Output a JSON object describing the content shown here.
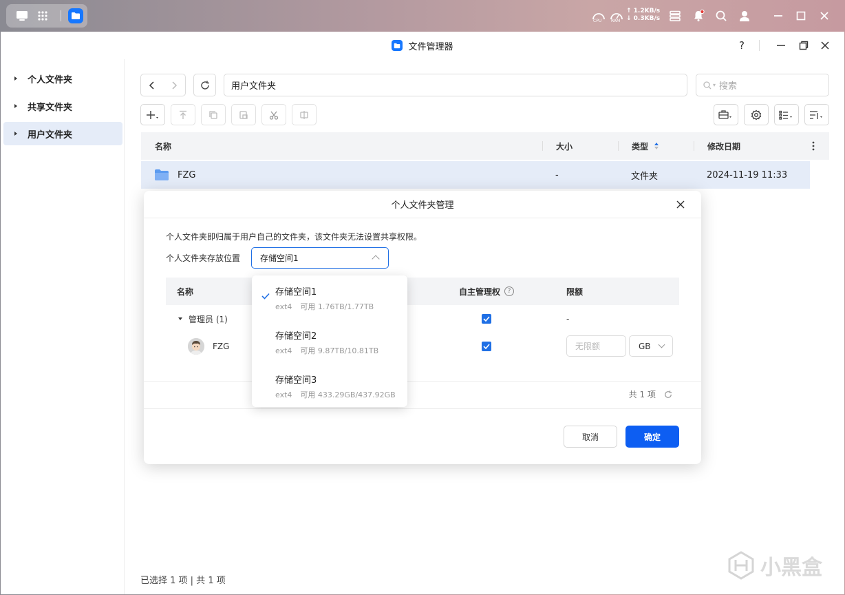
{
  "taskbar": {
    "cpu_label": "CPU",
    "ram_label": "RAM",
    "upload_speed": "↑ 1.2KB/s",
    "download_speed": "↓ 0.3KB/s",
    "notification_dot_color": "#e53935"
  },
  "window": {
    "title": "文件管理器",
    "help_label": "?"
  },
  "sidebar": {
    "items": [
      {
        "label": "个人文件夹",
        "active": false
      },
      {
        "label": "共享文件夹",
        "active": false
      },
      {
        "label": "用户文件夹",
        "active": true
      }
    ]
  },
  "toolbar": {
    "path": "用户文件夹",
    "search_placeholder": "搜索"
  },
  "table": {
    "columns": [
      "名称",
      "大小",
      "类型",
      "修改日期"
    ],
    "sort_column": "类型",
    "rows": [
      {
        "name": "FZG",
        "size": "-",
        "type": "文件夹",
        "modified": "2024-11-19 11:33"
      }
    ]
  },
  "status": {
    "selection": "已选择 1 项 | 共 1 项"
  },
  "watermark": "小黑盒",
  "dialog": {
    "title": "个人文件夹管理",
    "description": "个人文件夹即归属于用户自己的文件夹，该文件夹无法设置共享权限。",
    "location_label": "个人文件夹存放位置",
    "location_value": "存储空间1",
    "columns": {
      "name": "名称",
      "self_manage": "自主管理权",
      "quota": "限额"
    },
    "group": {
      "label": "管理员 (1)",
      "quota": "-"
    },
    "user": {
      "name": "FZG",
      "quota_placeholder": "无限额",
      "unit": "GB"
    },
    "total": "共 1 项",
    "cancel": "取消",
    "confirm": "确定"
  },
  "dropdown": {
    "items": [
      {
        "name": "存储空间1",
        "fs": "ext4",
        "avail": "可用 1.76TB/1.77TB",
        "selected": true
      },
      {
        "name": "存储空间2",
        "fs": "ext4",
        "avail": "可用 9.87TB/10.81TB",
        "selected": false
      },
      {
        "name": "存储空间3",
        "fs": "ext4",
        "avail": "可用 433.29GB/437.92GB",
        "selected": false
      }
    ]
  },
  "colors": {
    "accent": "#1f6fe5",
    "primary_button": "#0d5ef2",
    "row_highlight": "#e5ecf8",
    "folder": "#5b9bf0"
  }
}
